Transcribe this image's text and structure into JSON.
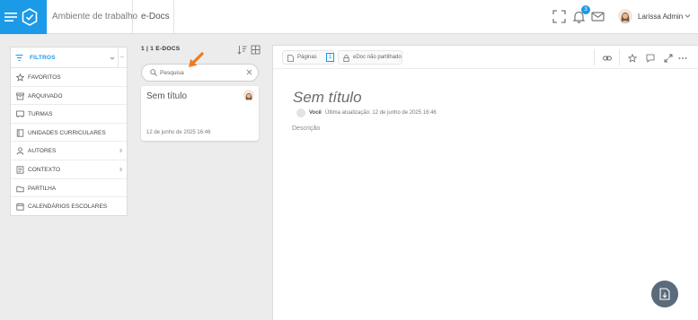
{
  "header": {
    "workspace_label": "Ambiente de trabalho",
    "app_name": "e-Docs",
    "notification_count": "3",
    "user_name": "Larissa Admin",
    "accent_color": "#1b9ae8"
  },
  "filters": {
    "title": "FILTROS",
    "items": [
      {
        "label": "FAVORITOS",
        "icon": "star-icon"
      },
      {
        "label": "ARQUIVADO",
        "icon": "archive-icon"
      },
      {
        "label": "TURMAS",
        "icon": "classroom-icon"
      },
      {
        "label": "UNIDADES CURRICULARES",
        "icon": "book-icon"
      },
      {
        "label": "AUTORES",
        "icon": "user-icon",
        "expandable": true
      },
      {
        "label": "CONTEXTO",
        "icon": "context-icon",
        "expandable": true
      },
      {
        "label": "PARTILHA",
        "icon": "share-icon"
      },
      {
        "label": "CALENDÁRIOS ESCOLARES",
        "icon": "calendar-icon"
      }
    ]
  },
  "list": {
    "count_label": "1 | 1  E-DOCS",
    "search_placeholder": "Pesquisa",
    "items": [
      {
        "title": "Sem título",
        "date": "12 de junho de 2025 16:46"
      }
    ]
  },
  "document": {
    "pages_label": "Páginas",
    "pages_count": "1",
    "share_status": "eDoc não partilhado",
    "title": "Sem título",
    "author": "Você",
    "updated": "Última atualização:  12 de junho de 2025 16:46",
    "description_label": "Descrição"
  }
}
